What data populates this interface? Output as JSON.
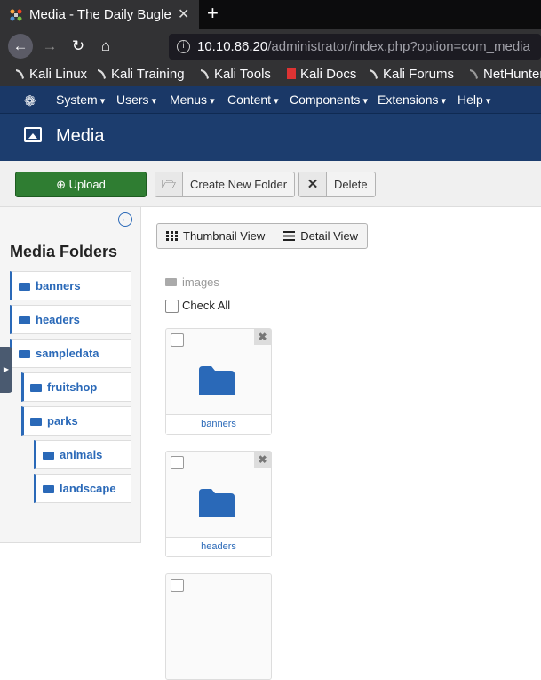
{
  "browser": {
    "tab_title": "Media - The Daily Bugle",
    "tab_close": "✕",
    "new_tab": "+",
    "url_host": "10.10.86.20",
    "url_path": "/administrator/index.php?option=com_media",
    "bookmarks": [
      "Kali Linux",
      "Kali Training",
      "Kali Tools",
      "Kali Docs",
      "Kali Forums",
      "NetHunter"
    ]
  },
  "admin_nav": {
    "items": [
      "System",
      "Users",
      "Menus",
      "Content",
      "Components",
      "Extensions",
      "Help"
    ]
  },
  "header": {
    "title": "Media"
  },
  "toolbar": {
    "upload_label": "Upload",
    "new_folder_label": "Create New Folder",
    "delete_label": "Delete"
  },
  "sidebar": {
    "title": "Media Folders",
    "folders": [
      "banners",
      "headers",
      "sampledata",
      "fruitshop",
      "parks",
      "animals",
      "landscape"
    ]
  },
  "views": {
    "thumbnail_label": "Thumbnail View",
    "detail_label": "Detail View"
  },
  "content": {
    "breadcrumb": "images",
    "check_all_label": "Check All",
    "items": [
      {
        "name": "banners"
      },
      {
        "name": "headers"
      }
    ]
  },
  "colors": {
    "nav_bg": "#1a3867",
    "header_bg": "#1c3d6e",
    "upload_green": "#2f7d32",
    "folder_blue": "#2a69b8"
  }
}
